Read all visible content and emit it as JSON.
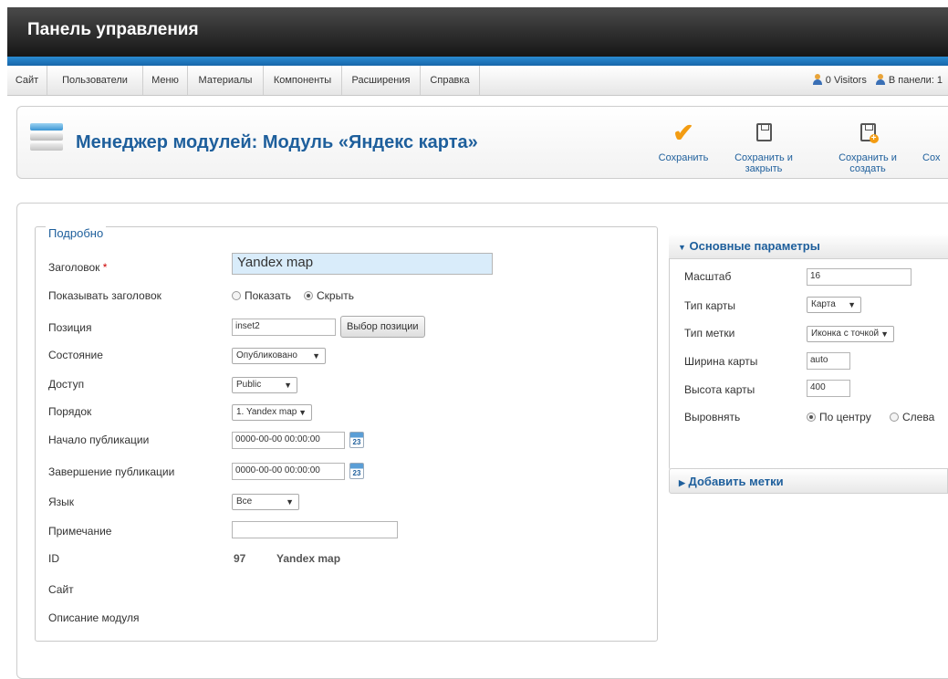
{
  "header": {
    "title": "Панель управления"
  },
  "menu": {
    "items": [
      "Сайт",
      "Пользователи",
      "Меню",
      "Материалы",
      "Компоненты",
      "Расширения",
      "Справка"
    ],
    "visitors": "0 Visitors",
    "admins": "В панели: 1"
  },
  "toolbar": {
    "title": "Менеджер модулей: Модуль «Яндекс карта»",
    "save": "Сохранить",
    "save_close": "Сохранить и закрыть",
    "save_new": "Сохранить и создать",
    "save_copy_partial": "Сох"
  },
  "details": {
    "legend": "Подробно",
    "title_label": "Заголовок",
    "required_mark": "*",
    "title_value": "Yandex map",
    "show_title_label": "Показывать заголовок",
    "show_option": "Показать",
    "hide_option": "Скрыть",
    "position_label": "Позиция",
    "position_value": "inset2",
    "position_button": "Выбор позиции",
    "state_label": "Состояние",
    "state_value": "Опубликовано",
    "access_label": "Доступ",
    "access_value": "Public",
    "order_label": "Порядок",
    "order_value": "1. Yandex map",
    "publish_up_label": "Начало публикации",
    "publish_up_value": "0000-00-00 00:00:00",
    "publish_down_label": "Завершение публикации",
    "publish_down_value": "0000-00-00 00:00:00",
    "calendar_day": "23",
    "language_label": "Язык",
    "language_value": "Все",
    "note_label": "Примечание",
    "note_value": "",
    "id_label": "ID",
    "id_value": "97",
    "id_name": "Yandex map",
    "site_label": "Сайт",
    "description_label": "Описание модуля"
  },
  "params": {
    "header": "Основные параметры",
    "scale_label": "Масштаб",
    "scale_value": "16",
    "map_type_label": "Тип карты",
    "map_type_value": "Карта",
    "marker_type_label": "Тип метки",
    "marker_type_value": "Иконка с точкой",
    "width_label": "Ширина карты",
    "width_value": "auto",
    "height_label": "Высота карты",
    "height_value": "400",
    "align_label": "Выровнять",
    "align_center": "По центру",
    "align_left": "Слева",
    "add_markers": "Добавить метки"
  }
}
